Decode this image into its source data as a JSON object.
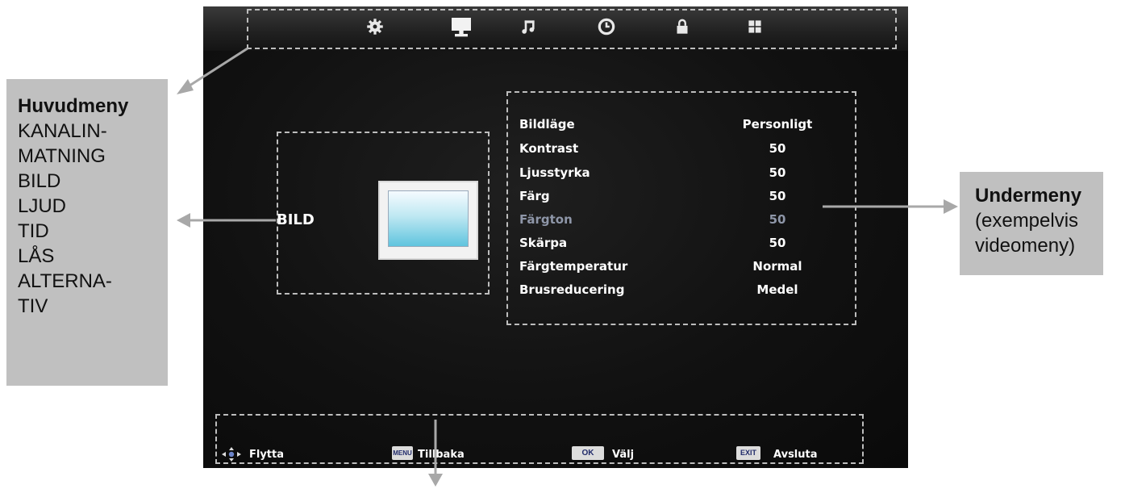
{
  "top_icons": [
    {
      "name": "channel-gear-icon"
    },
    {
      "name": "picture-monitor-icon"
    },
    {
      "name": "sound-note-icon"
    },
    {
      "name": "time-clock-icon"
    },
    {
      "name": "lock-icon"
    },
    {
      "name": "options-grid-icon"
    }
  ],
  "left_panel": {
    "label": "BILD"
  },
  "submenu": {
    "items": [
      {
        "label": "Bildläge",
        "value": "Personligt",
        "dim": false
      },
      {
        "label": "Kontrast",
        "value": "50",
        "dim": false
      },
      {
        "label": "Ljusstyrka",
        "value": "50",
        "dim": false
      },
      {
        "label": "Färg",
        "value": "50",
        "dim": false
      },
      {
        "label": "Färgton",
        "value": "50",
        "dim": true
      },
      {
        "label": "Skärpa",
        "value": "50",
        "dim": false
      },
      {
        "label": "Färgtemperatur",
        "value": "Normal",
        "dim": false
      },
      {
        "label": "Brusreducering",
        "value": "Medel",
        "dim": false
      }
    ]
  },
  "bottom_bar": {
    "move": "Flytta",
    "menu_key": "MENU",
    "back": "Tillbaka",
    "ok_key": "OK",
    "select": "Välj",
    "exit_key": "EXIT",
    "quit": "Avsluta"
  },
  "callout_main": {
    "title": "Huvudmeny",
    "lines": [
      "KANALIN-",
      "MATNING",
      "BILD",
      "LJUD",
      "TID",
      "LÅS",
      "ALTERNA-",
      "TIV"
    ]
  },
  "callout_sub": {
    "title": "Undermeny",
    "lines": [
      "(exempelvis",
      "videomeny)"
    ]
  },
  "colors": {
    "screen_bg": "#141414",
    "callout_bg": "#c0c0c0",
    "dim_text": "#8e96a8",
    "arrow": "#a8a8a8"
  }
}
